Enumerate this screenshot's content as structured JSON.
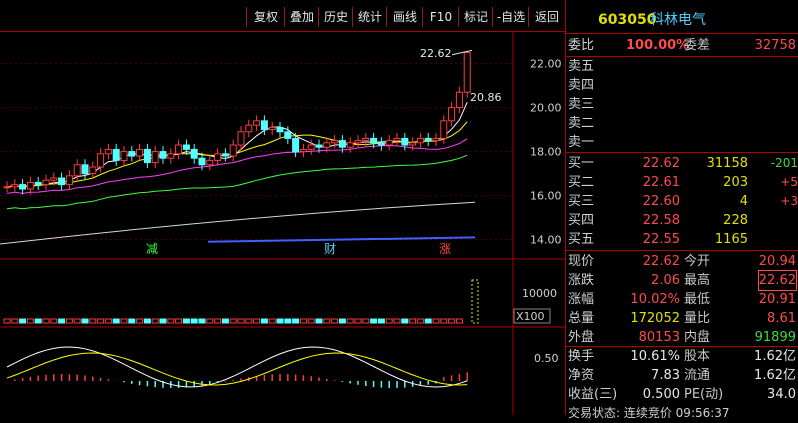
{
  "toolbar": {
    "buttons": [
      "复权",
      "叠加",
      "历史",
      "统计",
      "画线",
      "F10",
      "标记",
      "-自选",
      "返回"
    ]
  },
  "stock": {
    "code": "603050",
    "name": "科林电气"
  },
  "chart_data": {
    "type": "candlestick",
    "price_axis": {
      "ticks": [
        22.0,
        20.0,
        18.0,
        16.0,
        14.0
      ],
      "ylim": [
        13.3,
        23.3
      ]
    },
    "annotations": {
      "high_label": "22.62",
      "close_label": "20.86",
      "signals": [
        "减",
        "财",
        "涨"
      ]
    },
    "volume_axis": {
      "tick": "10000",
      "unit": "X100"
    },
    "macd_axis": {
      "tick": "0.50"
    }
  },
  "quote": {
    "weibi_label": "委比",
    "weibi_value": "100.00%",
    "weicha_label": "委差",
    "weicha_value": "32758",
    "sell": [
      {
        "label": "卖五"
      },
      {
        "label": "卖四"
      },
      {
        "label": "卖三"
      },
      {
        "label": "卖二"
      },
      {
        "label": "卖一"
      }
    ],
    "buy": [
      {
        "label": "买一",
        "price": "22.62",
        "vol": "31158",
        "chg": "-201"
      },
      {
        "label": "买二",
        "price": "22.61",
        "vol": "203",
        "chg": "+5"
      },
      {
        "label": "买三",
        "price": "22.60",
        "vol": "4",
        "chg": "+3"
      },
      {
        "label": "买四",
        "price": "22.58",
        "vol": "228",
        "chg": ""
      },
      {
        "label": "买五",
        "price": "22.55",
        "vol": "1165",
        "chg": ""
      }
    ],
    "stats": [
      {
        "l1": "现价",
        "v1": "22.62",
        "c1": "red",
        "l2": "今开",
        "v2": "20.94",
        "c2": "red"
      },
      {
        "l1": "涨跌",
        "v1": "2.06",
        "c1": "red",
        "l2": "最高",
        "v2": "22.62",
        "c2": "red"
      },
      {
        "l1": "涨幅",
        "v1": "10.02%",
        "c1": "red",
        "l2": "最低",
        "v2": "20.91",
        "c2": "red"
      },
      {
        "l1": "总量",
        "v1": "172052",
        "c1": "yellow",
        "l2": "量比",
        "v2": "8.61",
        "c2": "red"
      },
      {
        "l1": "外盘",
        "v1": "80153",
        "c1": "red",
        "l2": "内盘",
        "v2": "91899",
        "c2": "green"
      },
      {
        "l1": "换手",
        "v1": "10.61%",
        "c1": "white",
        "l2": "股本",
        "v2": "1.62亿",
        "c2": "white"
      },
      {
        "l1": "净资",
        "v1": "7.83",
        "c1": "white",
        "l2": "流通",
        "v2": "1.62亿",
        "c2": "white"
      },
      {
        "l1": "收益(三)",
        "v1": "0.500",
        "c1": "white",
        "l2": "PE(动)",
        "v2": "34.0",
        "c2": "white"
      }
    ],
    "footer": "交易状态: 连续竞价 09:56:37"
  }
}
